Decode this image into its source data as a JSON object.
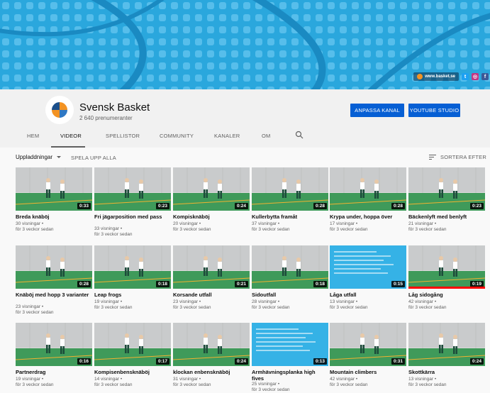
{
  "banner": {
    "site": "www.basket.se",
    "social": [
      "twitter",
      "instagram",
      "facebook"
    ]
  },
  "channel": {
    "name": "Svensk Basket",
    "subscribers": "2 640 prenumeranter",
    "customize_label": "ANPASSA KANAL",
    "studio_label": "YOUTUBE STUDIO"
  },
  "tabs": [
    {
      "label": "HEM",
      "active": false
    },
    {
      "label": "VIDEOR",
      "active": true
    },
    {
      "label": "SPELLISTOR",
      "active": false
    },
    {
      "label": "COMMUNITY",
      "active": false
    },
    {
      "label": "KANALER",
      "active": false
    },
    {
      "label": "OM",
      "active": false
    }
  ],
  "toolbar": {
    "uploads_label": "Uppladdningar",
    "play_all_label": "SPELA UPP ALLA",
    "sort_label": "SORTERA EFTER"
  },
  "colors": {
    "accent": "#065fd4",
    "banner": "#2aa7dd",
    "progress": "#ff0000"
  },
  "videos": [
    {
      "title": "Breda knäböj",
      "duration": "0:33",
      "views": "30 visningar •",
      "age": "för 3 veckor sedan",
      "watched": false
    },
    {
      "title": "Fri jägarposition med pass",
      "duration": "0:23",
      "views": "33 visningar •",
      "age": "för 3 veckor sedan",
      "watched": false
    },
    {
      "title": "Kompisknäböj",
      "duration": "0:24",
      "views": "20 visningar •",
      "age": "för 3 veckor sedan",
      "watched": false
    },
    {
      "title": "Kullerbytta framåt",
      "duration": "0:28",
      "views": "37 visningar •",
      "age": "för 3 veckor sedan",
      "watched": false
    },
    {
      "title": "Krypa under, hoppa över",
      "duration": "0:28",
      "views": "17 visningar •",
      "age": "för 3 veckor sedan",
      "watched": false
    },
    {
      "title": "Bäckenlyft med benlyft",
      "duration": "0:23",
      "views": "21 visningar •",
      "age": "för 3 veckor sedan",
      "watched": false
    },
    {
      "title": "Knäböj med hopp 3 varianter",
      "duration": "0:28",
      "views": "23 visningar •",
      "age": "för 3 veckor sedan",
      "watched": false
    },
    {
      "title": "Leap frogs",
      "duration": "0:18",
      "views": "19 visningar •",
      "age": "för 3 veckor sedan",
      "watched": false
    },
    {
      "title": "Korsande utfall",
      "duration": "0:21",
      "views": "23 visningar •",
      "age": "för 3 veckor sedan",
      "watched": false
    },
    {
      "title": "Sidoutfall",
      "duration": "0:18",
      "views": "28 visningar •",
      "age": "för 3 veckor sedan",
      "watched": false
    },
    {
      "title": "Låga utfall",
      "duration": "0:15",
      "views": "13 visningar •",
      "age": "för 3 veckor sedan",
      "watched": false
    },
    {
      "title": "Låg sidogång",
      "duration": "0:19",
      "views": "42 visningar •",
      "age": "för 3 veckor sedan",
      "watched": true
    },
    {
      "title": "Partnerdrag",
      "duration": "0:16",
      "views": "19 visningar •",
      "age": "för 3 veckor sedan",
      "watched": false
    },
    {
      "title": "Kompisenbensknäböj",
      "duration": "0:17",
      "views": "14 visningar •",
      "age": "för 3 veckor sedan",
      "watched": false
    },
    {
      "title": "klockan enbensknäböj",
      "duration": "0:24",
      "views": "31 visningar •",
      "age": "för 3 veckor sedan",
      "watched": false
    },
    {
      "title": "Armhävningsplanka high fives",
      "duration": "0:13",
      "views": "25 visningar •",
      "age": "för 3 veckor sedan",
      "watched": false
    },
    {
      "title": "Mountain climbers",
      "duration": "0:31",
      "views": "42 visningar •",
      "age": "för 3 veckor sedan",
      "watched": false
    },
    {
      "title": "Skottkärra",
      "duration": "0:24",
      "views": "13 visningar •",
      "age": "för 3 veckor sedan",
      "watched": false
    }
  ]
}
